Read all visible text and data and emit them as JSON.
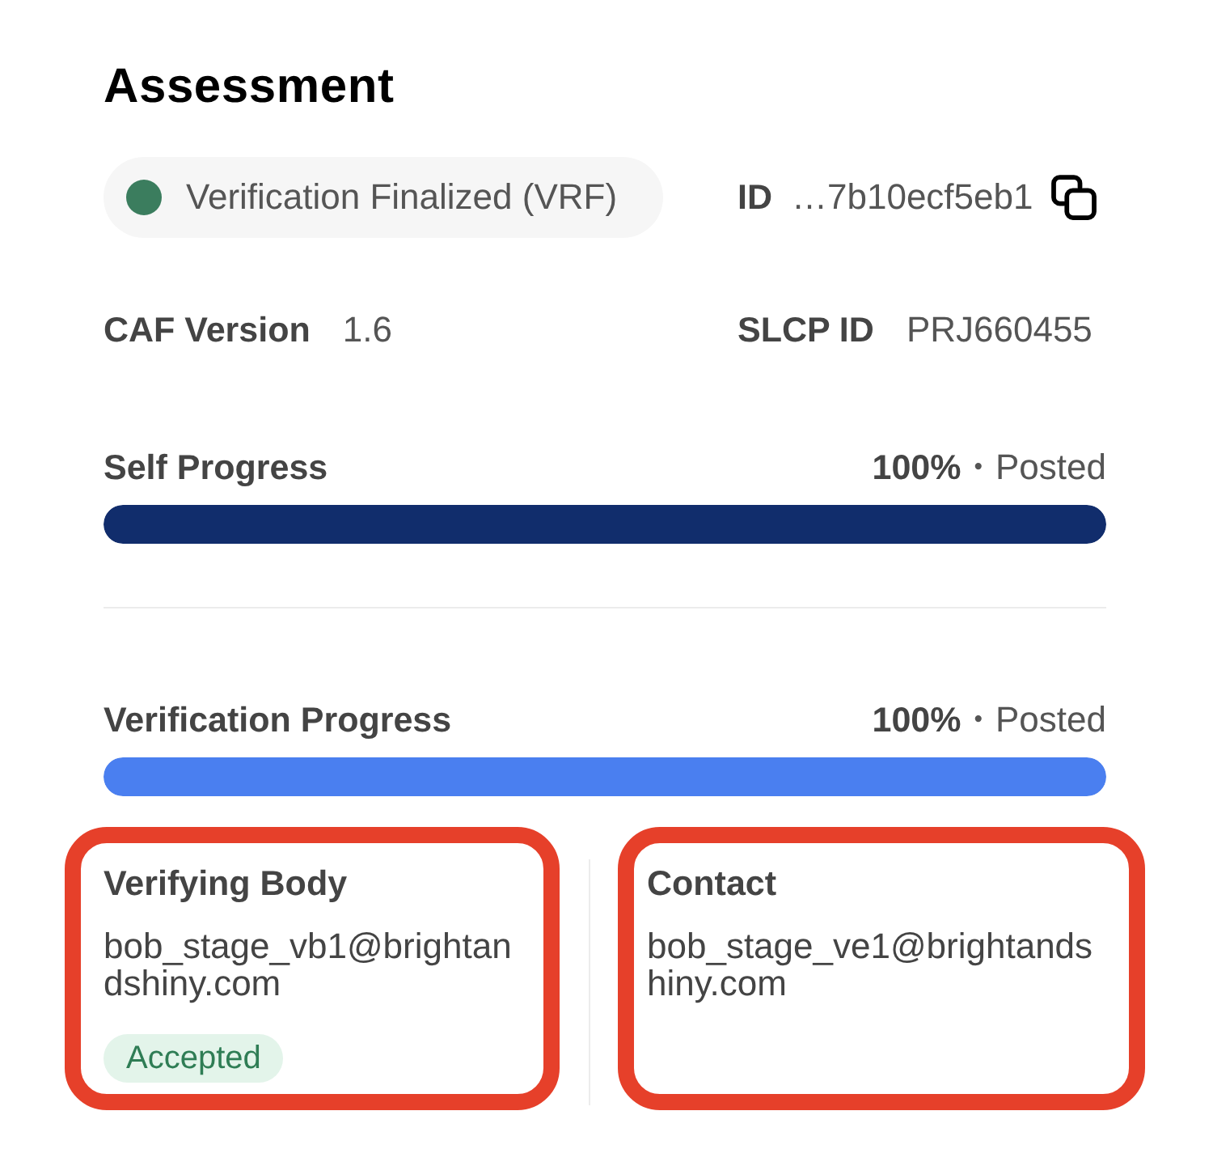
{
  "title": "Assessment",
  "status": {
    "label": "Verification Finalized (VRF)",
    "color": "#3b7d5e"
  },
  "id": {
    "label": "ID",
    "value": "…7b10ecf5eb1"
  },
  "fields": [
    {
      "label": "CAF Version",
      "value": "1.6"
    },
    {
      "label": "SLCP ID",
      "value": "PRJ660455"
    }
  ],
  "progress": [
    {
      "label": "Self Progress",
      "percent": "100%",
      "separator": "•",
      "status": "Posted",
      "level": 1,
      "color": "#112d6c"
    },
    {
      "label": "Verification Progress",
      "percent": "100%",
      "separator": "•",
      "status": "Posted",
      "level": 1,
      "color": "#4a7ff0"
    }
  ],
  "parties": [
    {
      "label": "Verifying Body",
      "email": "bob_stage_vb1@brightandshiny.com",
      "badge": "Accepted",
      "highlighted": true
    },
    {
      "label": "Contact",
      "email": "bob_stage_ve1@brightandshiny.com",
      "highlighted": true
    }
  ]
}
